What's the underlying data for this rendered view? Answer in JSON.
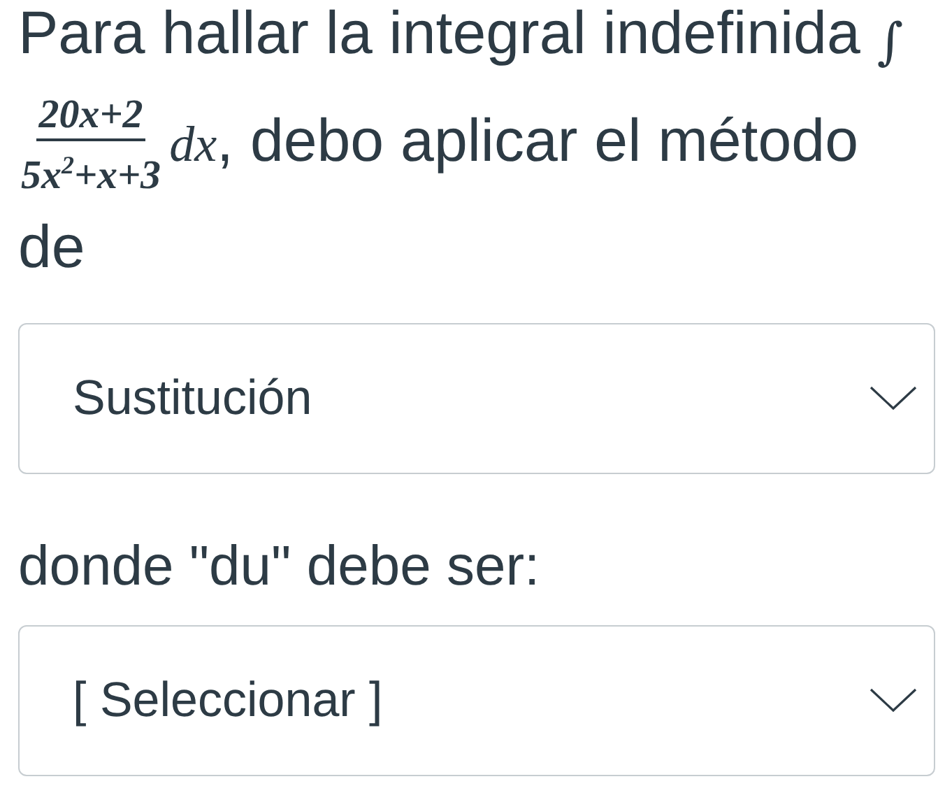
{
  "question": {
    "text_before": "Para hallar la integral indefinida",
    "integral_sign": "∫",
    "numerator": "20x+2",
    "denominator": "5x$^{2}$+x+3",
    "differential": "dx",
    "text_after": ", debo aplicar el método de"
  },
  "dropdowns": [
    {
      "value": "Sustitución"
    },
    {
      "value": "[ Seleccionar ]"
    }
  ],
  "text_between": "donde \"du\" debe ser:"
}
